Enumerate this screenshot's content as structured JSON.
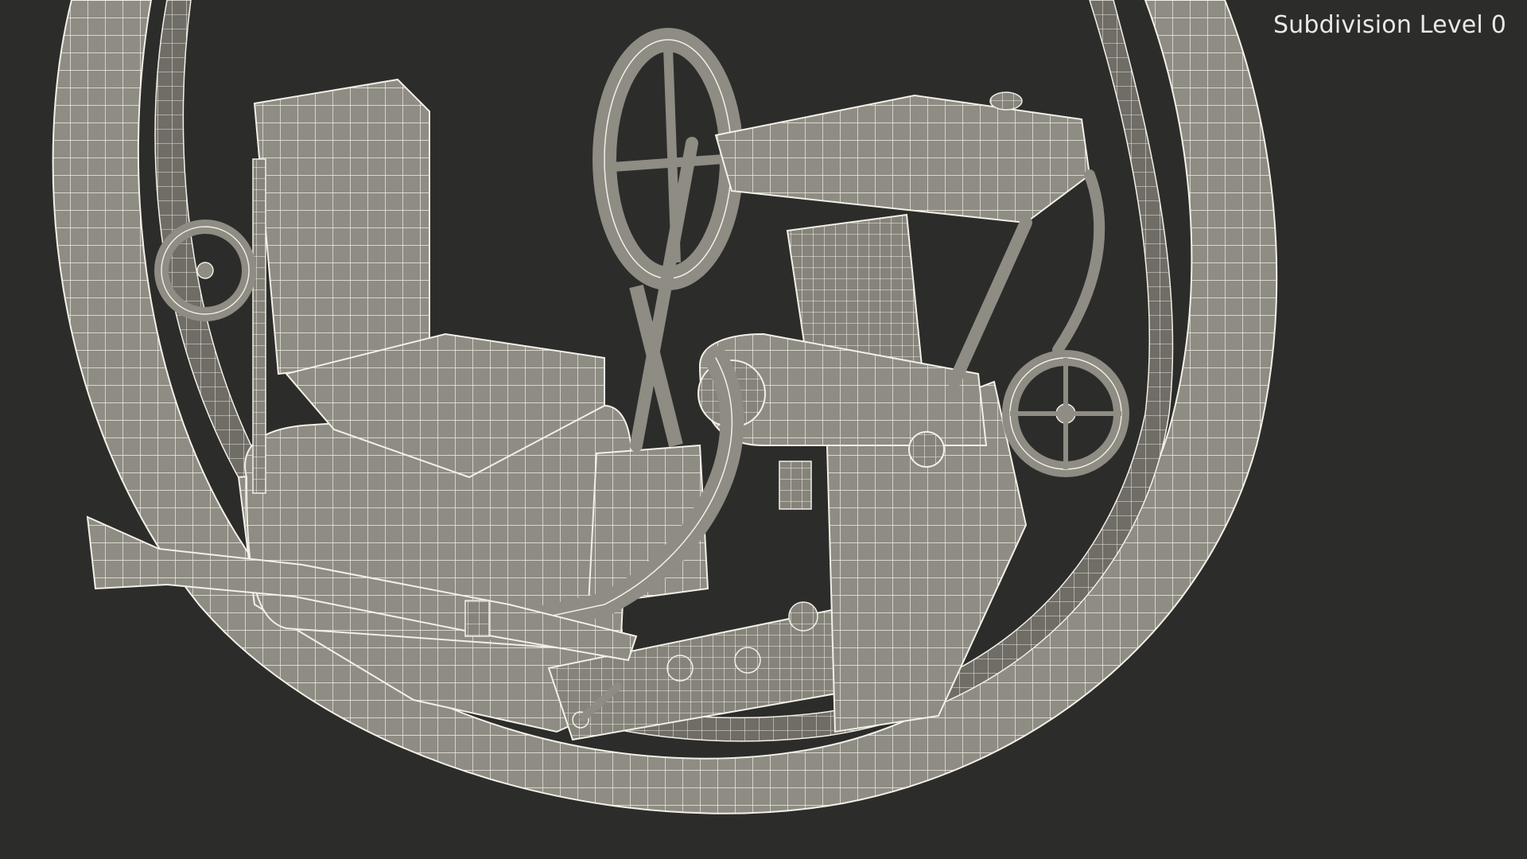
{
  "viewport": {
    "overlay_label": "Subdivision Level 0",
    "background_color": "#2c2c2b",
    "mesh_fill_color": "#8e8c83",
    "wire_color": "#f2f0e6"
  },
  "model": {
    "subject": "monowheel-wireframe",
    "parts": [
      "outer-wheel",
      "inner-rail",
      "seat",
      "steering-wheel",
      "fuel-tank",
      "engine",
      "exhaust-pipe",
      "side-wheel-left",
      "side-wheel-right",
      "chassis",
      "foot-pegs"
    ]
  }
}
